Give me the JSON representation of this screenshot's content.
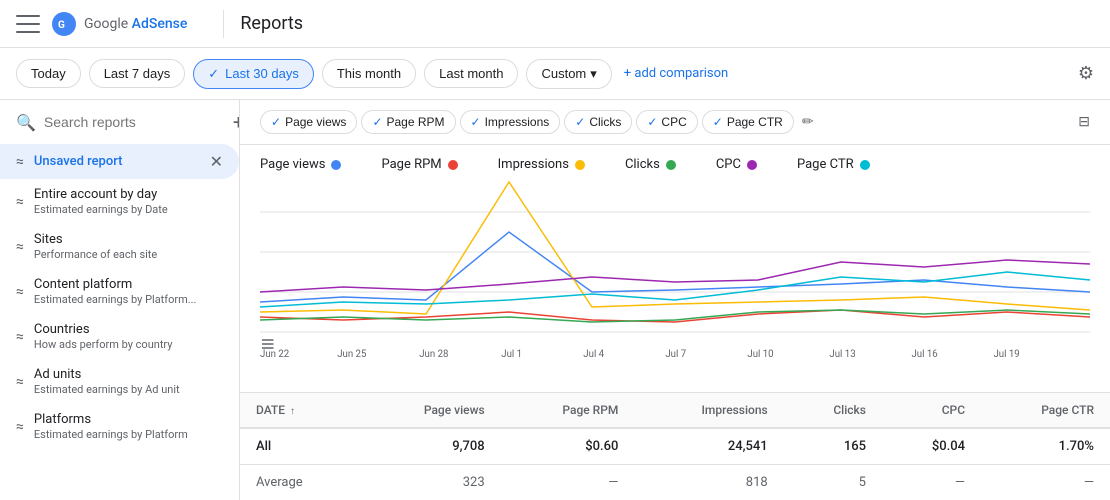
{
  "topNav": {
    "menuLabel": "Menu",
    "logoText": "Google AdSense",
    "divider": "|",
    "pageTitle": "Reports"
  },
  "filterBar": {
    "buttons": [
      {
        "id": "today",
        "label": "Today",
        "active": false
      },
      {
        "id": "last7",
        "label": "Last 7 days",
        "active": false
      },
      {
        "id": "last30",
        "label": "Last 30 days",
        "active": true,
        "check": "✓"
      },
      {
        "id": "thismonth",
        "label": "This month",
        "active": false
      },
      {
        "id": "lastmonth",
        "label": "Last month",
        "active": false
      },
      {
        "id": "custom",
        "label": "Custom",
        "active": false,
        "dropdown": true
      }
    ],
    "addComparison": "+ add comparison",
    "settingsIcon": "⚙"
  },
  "sidebar": {
    "searchPlaceholder": "Search reports",
    "addIcon": "+",
    "items": [
      {
        "id": "unsaved",
        "name": "Unsaved report",
        "desc": "",
        "icon": "≈",
        "active": true,
        "close": true
      },
      {
        "id": "entire",
        "name": "Entire account by day",
        "desc": "Estimated earnings by Date",
        "icon": "≈"
      },
      {
        "id": "sites",
        "name": "Sites",
        "desc": "Performance of each site",
        "icon": "≈"
      },
      {
        "id": "content",
        "name": "Content platform",
        "desc": "Estimated earnings by Platform...",
        "icon": "≈"
      },
      {
        "id": "countries",
        "name": "Countries",
        "desc": "How ads perform by country",
        "icon": "≈"
      },
      {
        "id": "adunits",
        "name": "Ad units",
        "desc": "Estimated earnings by Ad unit",
        "icon": "≈"
      },
      {
        "id": "platforms",
        "name": "Platforms",
        "desc": "Estimated earnings by Platform",
        "icon": "≈"
      }
    ]
  },
  "chartFilters": [
    {
      "id": "pageviews",
      "label": "Page views",
      "color": "#4285f4",
      "active": true
    },
    {
      "id": "pagerpm",
      "label": "Page RPM",
      "color": "#ea4335",
      "active": true
    },
    {
      "id": "impressions",
      "label": "Impressions",
      "color": "#fbbc04",
      "active": true
    },
    {
      "id": "clicks",
      "label": "Clicks",
      "color": "#34a853",
      "active": true
    },
    {
      "id": "cpc",
      "label": "CPC",
      "color": "#9c27b0",
      "active": true
    },
    {
      "id": "pagectr",
      "label": "Page CTR",
      "color": "#00bcd4",
      "active": true
    }
  ],
  "chartLegend": [
    {
      "label": "Page views",
      "color": "#4285f4"
    },
    {
      "label": "Page RPM",
      "color": "#ea4335"
    },
    {
      "label": "Impressions",
      "color": "#fbbc04"
    },
    {
      "label": "Clicks",
      "color": "#34a853"
    },
    {
      "label": "CPC",
      "color": "#9c27b0"
    },
    {
      "label": "Page CTR",
      "color": "#00bcd4"
    }
  ],
  "chart": {
    "xLabels": [
      "Jun 22",
      "Jun 25",
      "Jun 28",
      "Jul 1",
      "Jul 4",
      "Jul 7",
      "Jul 10",
      "Jul 13",
      "Jul 16",
      "Jul 19"
    ],
    "colors": {
      "pageviews": "#4285f4",
      "pagerpm": "#ea4335",
      "impressions": "#fbbc04",
      "clicks": "#34a853",
      "cpc": "#9c27b0",
      "pagectr": "#00bcd4"
    }
  },
  "table": {
    "columns": [
      {
        "id": "date",
        "label": "DATE",
        "sortable": true
      },
      {
        "id": "pageviews",
        "label": "Page views",
        "align": "right"
      },
      {
        "id": "pagerpm",
        "label": "Page RPM",
        "align": "right"
      },
      {
        "id": "impressions",
        "label": "Impressions",
        "align": "right"
      },
      {
        "id": "clicks",
        "label": "Clicks",
        "align": "right"
      },
      {
        "id": "cpc",
        "label": "CPC",
        "align": "right"
      },
      {
        "id": "pagectr",
        "label": "Page CTR",
        "align": "right"
      }
    ],
    "rows": [
      {
        "date": "All",
        "pageviews": "9,708",
        "pagerpm": "$0.60",
        "impressions": "24,541",
        "clicks": "165",
        "cpc": "$0.04",
        "pagectr": "1.70%",
        "type": "total"
      },
      {
        "date": "Average",
        "pageviews": "323",
        "pagerpm": "—",
        "impressions": "818",
        "clicks": "5",
        "cpc": "—",
        "pagectr": "—",
        "type": "avg"
      }
    ]
  }
}
